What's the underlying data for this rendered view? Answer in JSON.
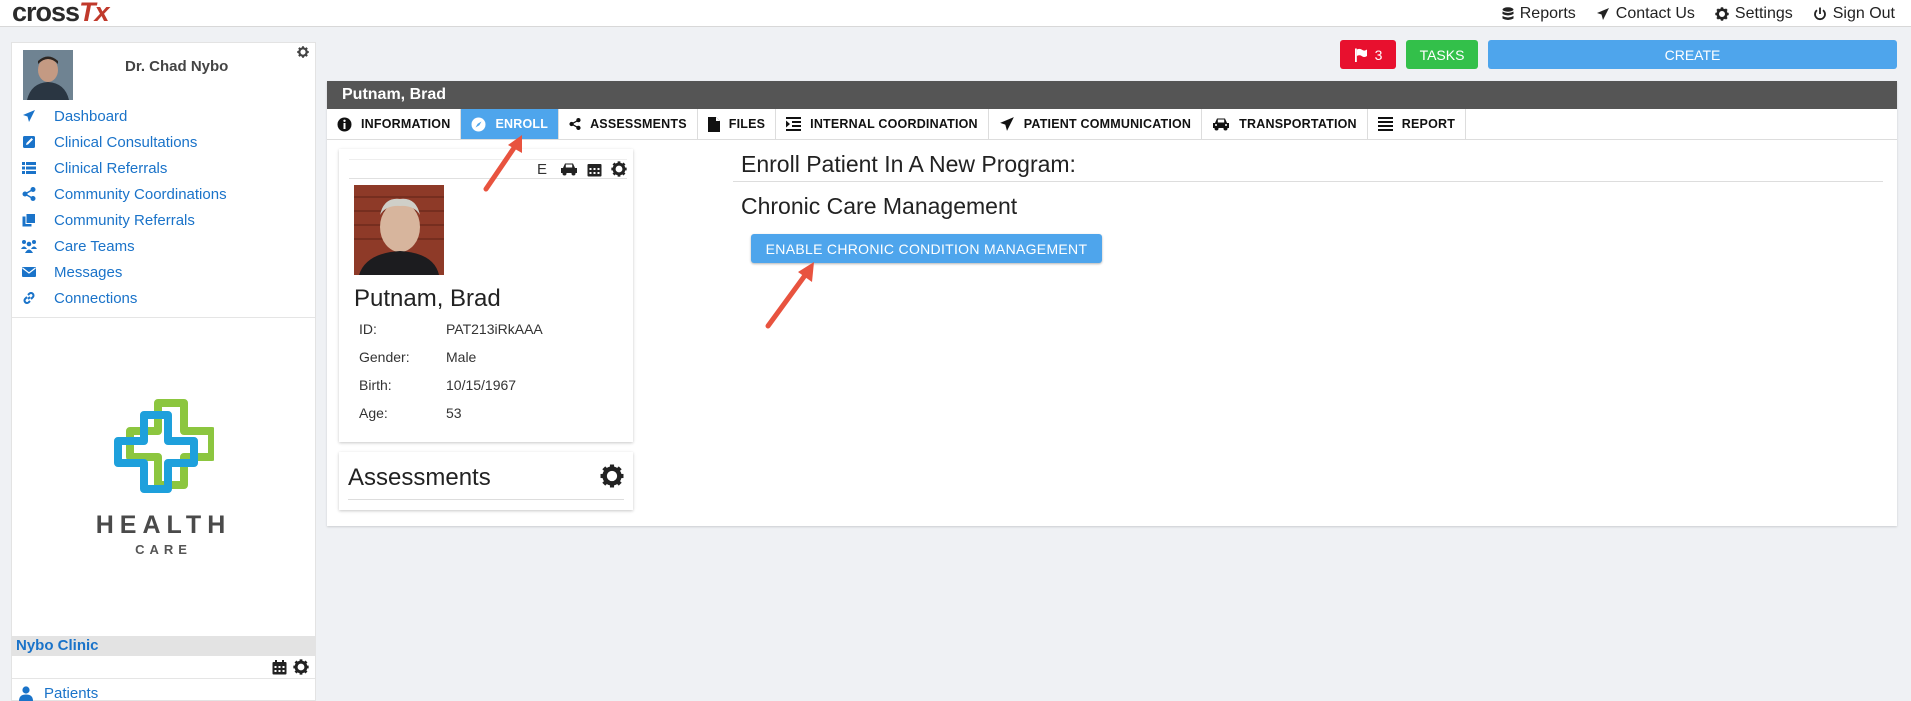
{
  "app": {
    "logo_main": "cross",
    "logo_accent": "Tx"
  },
  "top_nav": {
    "reports": "Reports",
    "contact": "Contact Us",
    "settings": "Settings",
    "signout": "Sign Out"
  },
  "sidebar": {
    "doctor_name": "Dr. Chad Nybo",
    "items": [
      {
        "label": "Dashboard",
        "icon": "paper-plane-icon"
      },
      {
        "label": "Clinical Consultations",
        "icon": "edit-square-icon"
      },
      {
        "label": "Clinical Referrals",
        "icon": "list-icon"
      },
      {
        "label": "Community Coordinations",
        "icon": "share-icon"
      },
      {
        "label": "Community Referrals",
        "icon": "copy-icon"
      },
      {
        "label": "Care Teams",
        "icon": "people-icon"
      },
      {
        "label": "Messages",
        "icon": "envelope-icon"
      },
      {
        "label": "Connections",
        "icon": "link-icon"
      }
    ],
    "brand_title": "HEALTH",
    "brand_sub": "CARE",
    "clinic_name": "Nybo Clinic",
    "patients_label": "Patients"
  },
  "actions": {
    "flag_count": "3",
    "tasks_label": "TASKS",
    "create_label": "CREATE"
  },
  "patient": {
    "header_name": "Putnam, Brad",
    "tabs": [
      {
        "label": "INFORMATION",
        "icon": "info-icon"
      },
      {
        "label": "ENROLL",
        "icon": "compass-icon"
      },
      {
        "label": "ASSESSMENTS",
        "icon": "share-icon"
      },
      {
        "label": "FILES",
        "icon": "file-icon"
      },
      {
        "label": "INTERNAL COORDINATION",
        "icon": "indent-icon"
      },
      {
        "label": "PATIENT COMMUNICATION",
        "icon": "paper-plane-icon"
      },
      {
        "label": "TRANSPORTATION",
        "icon": "car-icon"
      },
      {
        "label": "REPORT",
        "icon": "lines-icon"
      }
    ],
    "card_tool_letter": "E",
    "name": "Putnam, Brad",
    "info": [
      {
        "key": "ID:",
        "value": "PAT213iRkAAA"
      },
      {
        "key": "Gender:",
        "value": "Male"
      },
      {
        "key": "Birth:",
        "value": "10/15/1967"
      },
      {
        "key": "Age:",
        "value": "53"
      }
    ],
    "assessments_title": "Assessments"
  },
  "enroll": {
    "title": "Enroll Patient In A New Program:",
    "program": "Chronic Care Management",
    "enable_button": "ENABLE CHRONIC CONDITION MANAGEMENT"
  },
  "colors": {
    "accent_blue": "#4ea5ec",
    "link_blue": "#1a73c9",
    "flag_red": "#e8102e",
    "tasks_green": "#33c04a",
    "header_gray": "#555555",
    "annotation_arrow": "#e8533f"
  }
}
